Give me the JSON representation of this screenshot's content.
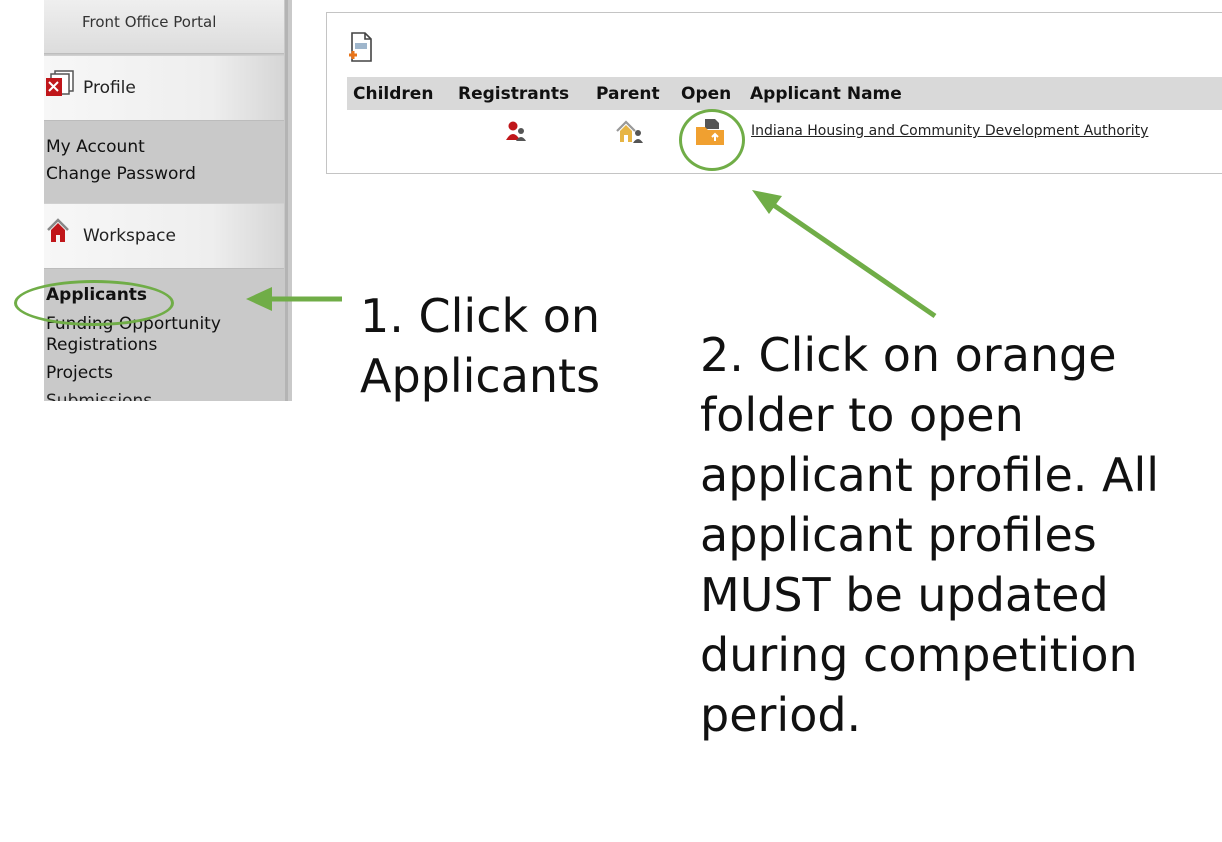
{
  "sidebar": {
    "portal_title": "Front Office Portal",
    "profile": {
      "header": "Profile",
      "links": [
        "My Account",
        "Change Password"
      ]
    },
    "workspace": {
      "header": "Workspace",
      "links": [
        "Applicants",
        "Funding Opportunity Registrations",
        "Projects",
        "Submissions"
      ]
    }
  },
  "table": {
    "columns": [
      "Children",
      "Registrants",
      "Parent",
      "Open",
      "Applicant Name"
    ],
    "rows": [
      {
        "applicant_name": "Indiana Housing and Community Development Authority"
      }
    ]
  },
  "annotations": {
    "step1": "1. Click on\nApplicants",
    "step2": "2. Click on orange\nfolder to open\napplicant profile. All\napplicant profiles\nMUST be updated\nduring competition\nperiod."
  },
  "colors": {
    "annotation_green": "#70ad47",
    "sidebar_gray": "#c9c9c9",
    "header_gray": "#d9d9d9",
    "folder_orange": "#f0a030",
    "registrant_red": "#c0161a"
  },
  "icons": [
    "add-record-icon",
    "registrants-icon",
    "parent-icon",
    "open-folder-icon",
    "profile-icon",
    "workspace-home-icon"
  ]
}
